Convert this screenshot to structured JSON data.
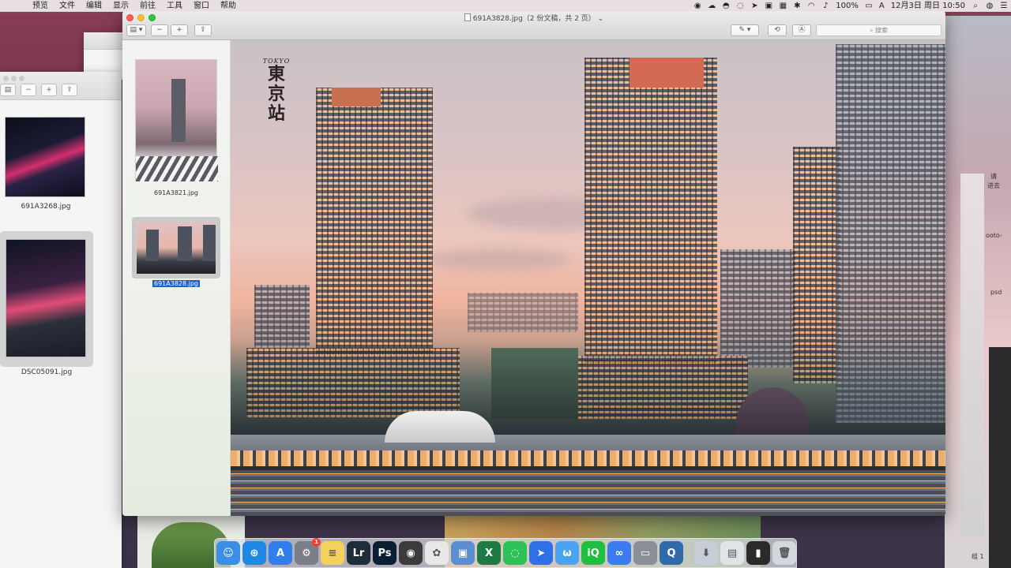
{
  "menubar": {
    "apple": "",
    "items": [
      "预览",
      "文件",
      "编辑",
      "显示",
      "前往",
      "工具",
      "窗口",
      "帮助"
    ],
    "battery": "100%",
    "input_method": "A",
    "datetime": "12月3日 周日 10:50"
  },
  "window": {
    "title": "691A3828.jpg（2 份文稿，共 2 页）",
    "search_placeholder": "搜索",
    "toolbar": {
      "sidebar_toggle": "▤ ▾",
      "zoom_out": "−",
      "zoom_in": "+",
      "share": "⇪",
      "markup": "✎ ▾",
      "rotate": "⟲",
      "annotate": "Ⓐ"
    }
  },
  "sidebar": {
    "thumbnails": [
      {
        "filename": "691A3821.jpg",
        "selected": false
      },
      {
        "filename": "691A3828.jpg",
        "selected": true
      }
    ]
  },
  "viewer": {
    "calligraphy_en": "TOKYO",
    "calligraphy_jp": [
      "東",
      "京",
      "站"
    ]
  },
  "background_window": {
    "thumbnails": [
      {
        "filename": "691A3268.jpg"
      },
      {
        "filename": "DSC05091.jpg"
      }
    ]
  },
  "right_window": {
    "labels": [
      "请",
      "进去",
      "ooto-",
      "psd",
      "组 1"
    ]
  },
  "dock": {
    "items": [
      {
        "name": "Finder",
        "glyph": "☺",
        "color": "#3a8ee6"
      },
      {
        "name": "Safari",
        "glyph": "⊕",
        "color": "#1e88e5"
      },
      {
        "name": "App Store",
        "glyph": "A",
        "color": "#2f80ed"
      },
      {
        "name": "System Preferences",
        "glyph": "⚙",
        "color": "#7a7f87",
        "badge": "1"
      },
      {
        "name": "Notes",
        "glyph": "≡",
        "color": "#f2d25c"
      },
      {
        "name": "Lightroom",
        "glyph": "Lr",
        "color": "#1f2d3a"
      },
      {
        "name": "Photoshop",
        "glyph": "Ps",
        "color": "#0b1f33"
      },
      {
        "name": "Camera",
        "glyph": "◉",
        "color": "#3b3b3b"
      },
      {
        "name": "Photos",
        "glyph": "✿",
        "color": "#e8e8e8"
      },
      {
        "name": "Preview",
        "glyph": "▣",
        "color": "#5b8fd1"
      },
      {
        "name": "Excel",
        "glyph": "X",
        "color": "#1d7a45"
      },
      {
        "name": "WeChat",
        "glyph": "◌",
        "color": "#2dc15a"
      },
      {
        "name": "Feishu",
        "glyph": "➤",
        "color": "#2f6fe8"
      },
      {
        "name": "Weiyun",
        "glyph": "ω",
        "color": "#4aa3f0"
      },
      {
        "name": "iQIYI",
        "glyph": "iQ",
        "color": "#1fbf3f"
      },
      {
        "name": "Baidu Netdisk",
        "glyph": "∞",
        "color": "#3a7cf0"
      },
      {
        "name": "Card Reader",
        "glyph": "▭",
        "color": "#8a8f96"
      },
      {
        "name": "QuickTime",
        "glyph": "Q",
        "color": "#2f6ba8"
      },
      {
        "name": "Downloads",
        "glyph": "⬇",
        "color": "#c7cdd6"
      },
      {
        "name": "Screenshot",
        "glyph": "▤",
        "color": "#e0e3e8"
      },
      {
        "name": "Terminal",
        "glyph": "▮",
        "color": "#2a2a2a"
      },
      {
        "name": "Trash",
        "glyph": "🗑",
        "color": "#d4d7dc"
      }
    ]
  }
}
